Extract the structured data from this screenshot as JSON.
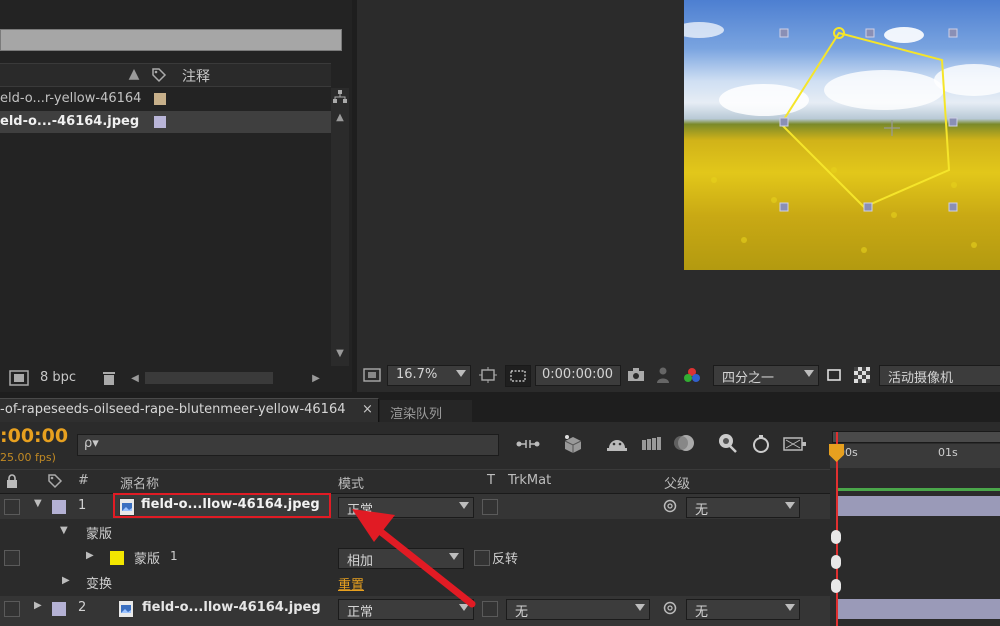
{
  "project": {
    "column_header_comment": "注释",
    "items": [
      {
        "name": "eld-o...r-yellow-46164",
        "color": "#c7b08a"
      },
      {
        "name": "eld-o...-46164.jpeg",
        "color": "#b9b5d8"
      }
    ],
    "bpc_label": "8 bpc"
  },
  "viewer": {
    "zoom": "16.7%",
    "timecode": "0:00:00:00",
    "resolution": "四分之一",
    "camera": "活动摄像机"
  },
  "comp_tabs": {
    "active_tab": "-of-rapeseeds-oilseed-rape-blutenmeer-yellow-46164",
    "render_queue_tab": "渲染队列"
  },
  "timeline": {
    "current_time": ":00:00",
    "fps": "25.00 fps)",
    "search_placeholder": "ρ▾",
    "headers": {
      "hash": "#",
      "source_name": "源名称",
      "mode": "模式",
      "t": "T",
      "trkmat": "TrkMat",
      "parent": "父级"
    },
    "ruler": {
      "start": "00s",
      "mark": "01s"
    },
    "layers": [
      {
        "num": "1",
        "name": "field-o...llow-46164.jpeg",
        "mode": "正常",
        "parent": "无",
        "label_color": "#b4b1d4"
      },
      {
        "num": "2",
        "name": "field-o...llow-46164.jpeg",
        "mode": "正常",
        "trkmat": "无",
        "parent": "无",
        "label_color": "#b4b1d4"
      }
    ],
    "masks_group": "蒙版",
    "mask": {
      "name": "蒙版",
      "index": "1",
      "mode": "相加",
      "invert_label": "反转",
      "color": "#f3e600"
    },
    "transform_group": "变换",
    "reset_link": "重置"
  }
}
